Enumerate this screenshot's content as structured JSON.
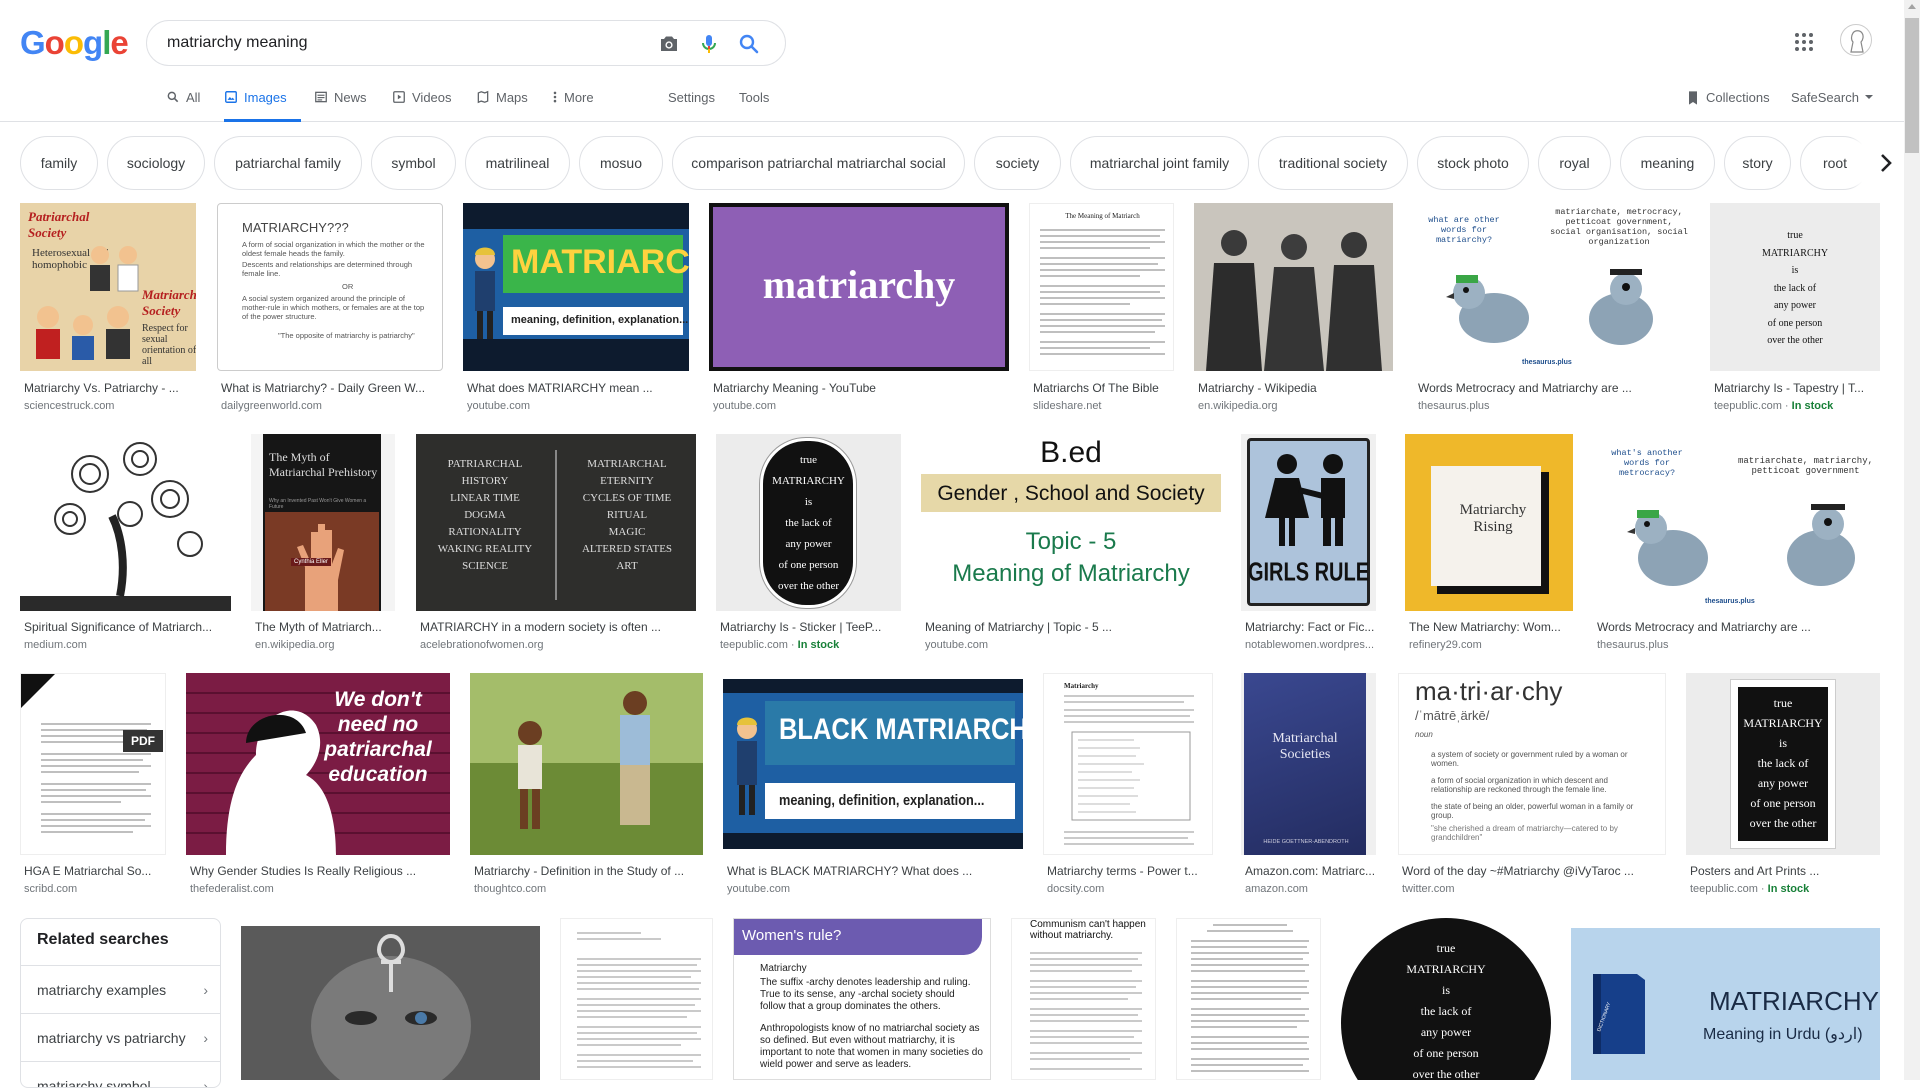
{
  "logo": {
    "letters": [
      "G",
      "o",
      "o",
      "g",
      "l",
      "e"
    ],
    "colors": [
      "#4285f4",
      "#ea4335",
      "#fbbc05",
      "#4285f4",
      "#34a853",
      "#ea4335"
    ]
  },
  "search": {
    "query": "matriarchy meaning"
  },
  "tabs": [
    {
      "label": "All",
      "icon": "search-icon",
      "active": false
    },
    {
      "label": "Images",
      "icon": "image-icon",
      "active": true
    },
    {
      "label": "News",
      "icon": "newspaper-icon",
      "active": false
    },
    {
      "label": "Videos",
      "icon": "play-icon",
      "active": false
    },
    {
      "label": "Maps",
      "icon": "map-icon",
      "active": false
    },
    {
      "label": "More",
      "icon": "vertical-dots-icon",
      "active": false
    },
    {
      "label": "Settings"
    },
    {
      "label": "Tools"
    }
  ],
  "right_tools": {
    "collections": "Collections",
    "safesearch": "SafeSearch"
  },
  "chips": [
    "family",
    "sociology",
    "patriarchal family",
    "symbol",
    "matrilineal",
    "mosuo",
    "comparison patriarchal matriarchal social",
    "society",
    "matriarchal joint family",
    "traditional society",
    "stock photo",
    "royal",
    "meaning",
    "story",
    "root"
  ],
  "results": [
    {
      "caption": "Matriarchy Vs. Patriarchy - ...",
      "source": "sciencestruck.com",
      "stock": ""
    },
    {
      "caption": "What is Matriarchy? - Daily Green W...",
      "source": "dailygreenworld.com",
      "stock": ""
    },
    {
      "caption": "What does MATRIARCHY mean ...",
      "source": "youtube.com",
      "stock": ""
    },
    {
      "caption": "Matriarchy Meaning - YouTube",
      "source": "youtube.com",
      "stock": ""
    },
    {
      "caption": "Matriarchs Of The Bible",
      "source": "slideshare.net",
      "stock": ""
    },
    {
      "caption": "Matriarchy - Wikipedia",
      "source": "en.wikipedia.org",
      "stock": ""
    },
    {
      "caption": "Words Metrocracy and Matriarchy are ...",
      "source": "thesaurus.plus",
      "stock": ""
    },
    {
      "caption": "Matriarchy Is - Tapestry | T...",
      "source": "teepublic.com",
      "stock": "In stock"
    },
    {
      "caption": "Spiritual Significance of Matriarch...",
      "source": "medium.com",
      "stock": ""
    },
    {
      "caption": "The Myth of Matriarch...",
      "source": "en.wikipedia.org",
      "stock": ""
    },
    {
      "caption": "MATRIARCHY in a modern society is often ...",
      "source": "acelebrationofwomen.org",
      "stock": ""
    },
    {
      "caption": "Matriarchy Is - Sticker | TeeP...",
      "source": "teepublic.com",
      "stock": "In stock"
    },
    {
      "caption": "Meaning of Matriarchy | Topic - 5 ...",
      "source": "youtube.com",
      "stock": ""
    },
    {
      "caption": "Matriarchy: Fact or Fic...",
      "source": "notablewomen.wordpres...",
      "stock": ""
    },
    {
      "caption": "The New Matriarchy: Wom...",
      "source": "refinery29.com",
      "stock": ""
    },
    {
      "caption": "Words Metrocracy and Matriarchy are ...",
      "source": "thesaurus.plus",
      "stock": ""
    },
    {
      "caption": "HGA E Matriarchal So...",
      "source": "scribd.com",
      "stock": ""
    },
    {
      "caption": "Why Gender Studies Is Really Religious ...",
      "source": "thefederalist.com",
      "stock": ""
    },
    {
      "caption": "Matriarchy - Definition in the Study of ...",
      "source": "thoughtco.com",
      "stock": ""
    },
    {
      "caption": "What is BLACK MATRIARCHY? What does ...",
      "source": "youtube.com",
      "stock": ""
    },
    {
      "caption": "Matriarchy terms - Power t...",
      "source": "docsity.com",
      "stock": ""
    },
    {
      "caption": "Amazon.com: Matriarc...",
      "source": "amazon.com",
      "stock": ""
    },
    {
      "caption": "Word of the day ~#Matriarchy @iVyTaroc ...",
      "source": "twitter.com",
      "stock": ""
    },
    {
      "caption": "Posters and Art Prints ...",
      "source": "teepublic.com",
      "stock": "In stock"
    }
  ],
  "image_text": {
    "r1_title1": "Patriarchal Society",
    "r1_sub1": "Heterosexual and homophobic",
    "r1_title2": "Matriarchal Society",
    "r1_sub2": "Respect for sexual orientation of all",
    "r2_title": "MATRIARCHY???",
    "r2_b1": "A form of social organization in which the mother or the oldest female heads the family.",
    "r2_b2": "Descents and relationships are determined through female line.",
    "r2_or": "OR",
    "r2_b3": "A social system organized around the principle of mother-rule in which mothers, or females are at the top of the power structure.",
    "r2_quote": "\"The opposite of matriarchy is patriarchy\"",
    "r3_word": "MATRIARCHY",
    "r3_band": "meaning, definition, explanation...",
    "r4_word": "matriarchy",
    "r5_title": "The Meaning of Matriarch",
    "r7_q": "what are other words for matriarchy?",
    "r7_a": "matriarchate, metrocracy, petticoat government, social organisation, social organization",
    "r7_brand": "thesaurus.plus",
    "true_lines": [
      "true",
      "MATRIARCHY",
      "is",
      "the lack of",
      "any power",
      "of one person",
      "over the other"
    ],
    "r10_title": "The Myth of Matriarchal Prehistory",
    "r10_sub": "Why an Invented Past Won't Give Women a Future",
    "r10_author": "Cynthia Eller",
    "r11_left": [
      "PATRIARCHAL",
      "HISTORY",
      "LINEAR TIME",
      "DOGMA",
      "RATIONALITY",
      "WAKING REALITY",
      "SCIENCE"
    ],
    "r11_right": [
      "MATRIARCHAL",
      "ETERNITY",
      "CYCLES OF TIME",
      "RITUAL",
      "MAGIC",
      "ALTERED STATES",
      "ART"
    ],
    "r13_head": "B.ed",
    "r13_band": "Gender , School and Society",
    "r13_topic": "Topic - 5",
    "r13_mean": "Meaning of Matriarchy",
    "r14_text": "GIRLS RULE",
    "r15_text": "Matriarchy Rising",
    "r16_q": "what's another words for metrocracy?",
    "r16_a": "matriarchate, matriarchy, petticoat government",
    "r17_badge": "PDF",
    "r18_text": "We don't need no patriarchal education",
    "r20_word": "BLACK MATRIARCHY",
    "r20_band": "meaning, definition, explanation...",
    "r21_title": "Matriarchy",
    "r22_title": "Matriarchal Societies",
    "r22_author": "HEIDE GOETTNER-ABENDROTH",
    "r23_word": "ma·tri·ar·chy",
    "r23_pron": "/ˈmātrēˌärkē/",
    "r23_pos": "noun",
    "r23_d1": "a system of society or government ruled by a woman or women.",
    "r23_d2": "a form of social organization in which descent and relationship are reckoned through the female line.",
    "r23_d3": "the state of being an older, powerful woman in a family or group.",
    "r23_ex": "\"she cherished a dream of matriarchy—catered to by grandchildren\"",
    "b3_title": "Women's rule?",
    "b3_l1": "Matriarchy",
    "b3_l2": "The suffix -archy denotes leadership and ruling. True to its sense, any -archal society should follow that a group dominates the others.",
    "b3_l3": "Anthropologists know of no matriarchal society as so defined. But even without matriarchy, it is important to note that women in many societies do wield power and serve as leaders.",
    "b4_title": "Communism can't happen without matriarchy.",
    "b7_word": "MATRIARCHY",
    "b7_sub": "Meaning in Urdu (اردو)",
    "b7_book": "DICTIONARY"
  },
  "related": {
    "title": "Related searches",
    "items": [
      "matriarchy examples",
      "matriarchy vs patriarchy",
      "matriarchy symbol"
    ]
  }
}
